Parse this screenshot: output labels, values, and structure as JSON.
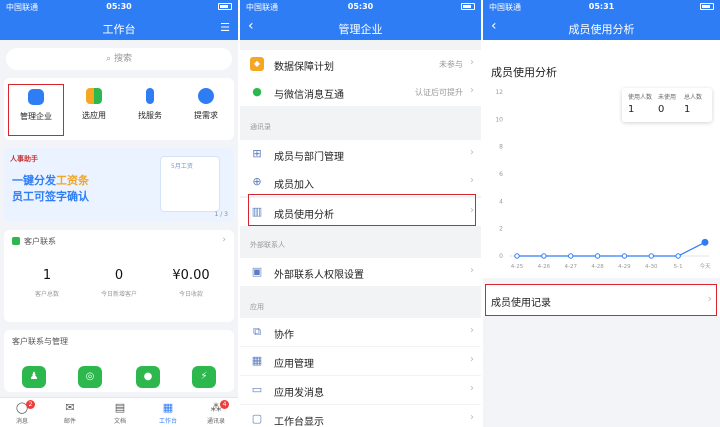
{
  "status": {
    "carrier": "中国联通",
    "times": [
      "05:30",
      "05:30",
      "05:31"
    ]
  },
  "panel1": {
    "title": "工作台",
    "search_placeholder": "搜索",
    "quick": [
      {
        "label": "管理企业",
        "icon": "hexagon-icon",
        "color": "#2f7df5"
      },
      {
        "label": "选应用",
        "icon": "apps-grid-icon",
        "color": "#f5a623"
      },
      {
        "label": "找服务",
        "icon": "necktie-icon",
        "color": "#2f7df5"
      },
      {
        "label": "提需求",
        "icon": "drops-icon",
        "color": "#2f7df5"
      }
    ],
    "banner": {
      "tag": "人事助手",
      "line1a": "一键分发",
      "line1b": "工资条",
      "line2": "员工可签字确认",
      "card_label": "5月工资",
      "pager": "1 / 3"
    },
    "crm": {
      "header": "客户联系",
      "stats": [
        {
          "value": "1",
          "label": "客户总数"
        },
        {
          "value": "0",
          "label": "今日新增客户"
        },
        {
          "value": "¥0.00",
          "label": "今日收款"
        }
      ]
    },
    "mgmt_header": "客户联系与管理",
    "tabs": [
      {
        "label": "消息",
        "icon": "chat-icon",
        "badge": "2"
      },
      {
        "label": "邮件",
        "icon": "mail-icon",
        "badge": ""
      },
      {
        "label": "文档",
        "icon": "doc-icon",
        "badge": ""
      },
      {
        "label": "工作台",
        "icon": "workbench-icon",
        "badge": ""
      },
      {
        "label": "通讯录",
        "icon": "contacts-icon",
        "badge": "4"
      }
    ]
  },
  "panel2": {
    "title": "管理企业",
    "rows_top": [
      {
        "label": "数据保障计划",
        "value": "未参与",
        "icon": "shield-icon",
        "color": "#f5a623"
      },
      {
        "label": "与微信消息互通",
        "value": "认证后可提升",
        "icon": "wechat-icon",
        "color": "#2db84d"
      }
    ],
    "section_contacts": "通讯录",
    "rows_contacts": [
      {
        "label": "成员与部门管理",
        "icon": "org-icon"
      },
      {
        "label": "成员加入",
        "icon": "add-member-icon"
      },
      {
        "label": "成员使用分析",
        "icon": "bar-chart-icon"
      }
    ],
    "section_external": "外部联系人",
    "rows_external": [
      {
        "label": "外部联系人权限设置",
        "icon": "id-card-icon"
      }
    ],
    "section_apps": "应用",
    "rows_apps": [
      {
        "label": "协作",
        "icon": "collab-icon"
      },
      {
        "label": "应用管理",
        "icon": "app-manage-icon"
      },
      {
        "label": "应用发消息",
        "icon": "message-icon"
      },
      {
        "label": "工作台显示",
        "icon": "display-icon"
      }
    ]
  },
  "panel3": {
    "title": "成员使用分析",
    "chart_title": "成员使用分析",
    "legend": [
      {
        "label": "使用人数",
        "value": "1"
      },
      {
        "label": "未使用",
        "value": "0"
      },
      {
        "label": "总人数",
        "value": "1"
      }
    ],
    "record_label": "成员使用记录"
  },
  "chart_data": {
    "type": "line",
    "title": "成员使用分析",
    "categories": [
      "4-25",
      "4-26",
      "4-27",
      "4-28",
      "4-29",
      "4-30",
      "5-1",
      "今天"
    ],
    "values": [
      0,
      0,
      0,
      0,
      0,
      0,
      0,
      1
    ],
    "ylim": [
      0,
      12
    ],
    "yticks": [
      0,
      2,
      4,
      6,
      8,
      10,
      12
    ],
    "grid": false,
    "line_color": "#2f7df5"
  }
}
